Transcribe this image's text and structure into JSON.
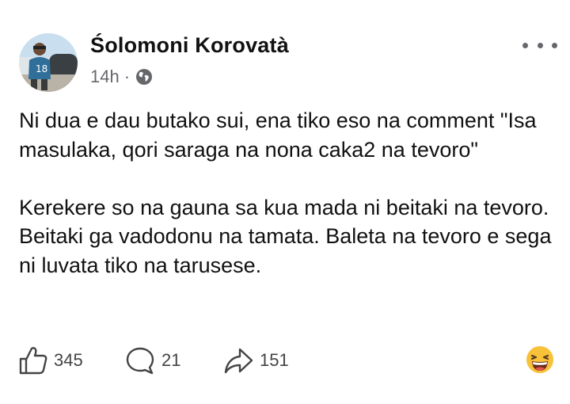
{
  "post": {
    "author_name": "Śolomoni Korovatà",
    "timestamp": "14h",
    "separator": "·",
    "audience_icon": "globe-icon",
    "more_icon": "more-horizontal-icon",
    "paragraphs": [
      "Ni dua e dau butako sui, ena tiko eso na comment \"Isa masulaka, qori saraga na nona caka2 na tevoro\"",
      "Kerekere so na gauna sa kua mada ni beitaki na tevoro. Beitaki ga vadodonu na tamata. Baleta na tevoro e sega ni luvata tiko na tarusese."
    ]
  },
  "actions": {
    "likes": "345",
    "comments": "21",
    "shares": "151",
    "like_icon": "thumbs-up-icon",
    "comment_icon": "comment-bubble-icon",
    "share_icon": "share-arrow-icon",
    "reaction_icon": "laughing-emoji-icon"
  },
  "colors": {
    "text": "#111111",
    "muted": "#65676b",
    "emoji": "#f7c13a"
  }
}
